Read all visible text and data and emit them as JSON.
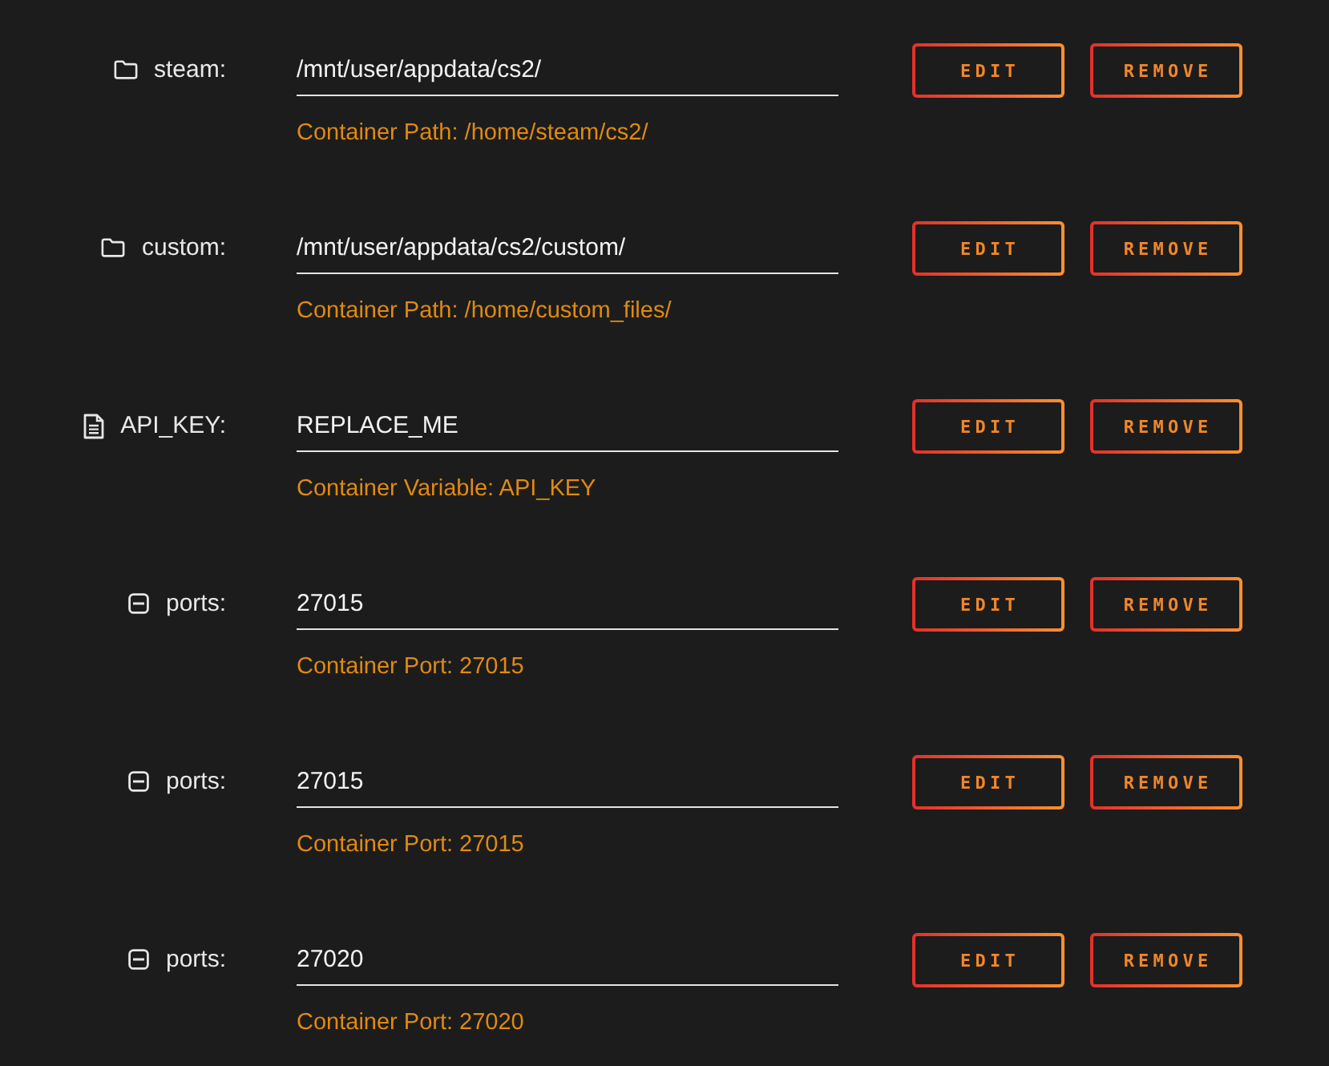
{
  "entries": [
    {
      "kind": "path",
      "name": "steam:",
      "value": "/mnt/user/appdata/cs2/",
      "description": "Container Path: /home/steam/cs2/",
      "actions": [
        "EDIT",
        "REMOVE"
      ]
    },
    {
      "kind": "path",
      "name": "custom:",
      "value": "/mnt/user/appdata/cs2/custom/",
      "description": "Container Path: /home/custom_files/",
      "actions": [
        "EDIT",
        "REMOVE"
      ]
    },
    {
      "kind": "variable",
      "name": "API_KEY:",
      "value": "REPLACE_ME",
      "description": "Container Variable: API_KEY",
      "actions": [
        "EDIT",
        "REMOVE"
      ]
    },
    {
      "kind": "port",
      "name": "ports:",
      "value": "27015",
      "description": "Container Port: 27015",
      "actions": [
        "EDIT",
        "REMOVE"
      ]
    },
    {
      "kind": "port",
      "name": "ports:",
      "value": "27015",
      "description": "Container Port: 27015",
      "actions": [
        "EDIT",
        "REMOVE"
      ]
    },
    {
      "kind": "port",
      "name": "ports:",
      "value": "27020",
      "description": "Container Port: 27020",
      "actions": [
        "EDIT",
        "REMOVE"
      ]
    }
  ]
}
